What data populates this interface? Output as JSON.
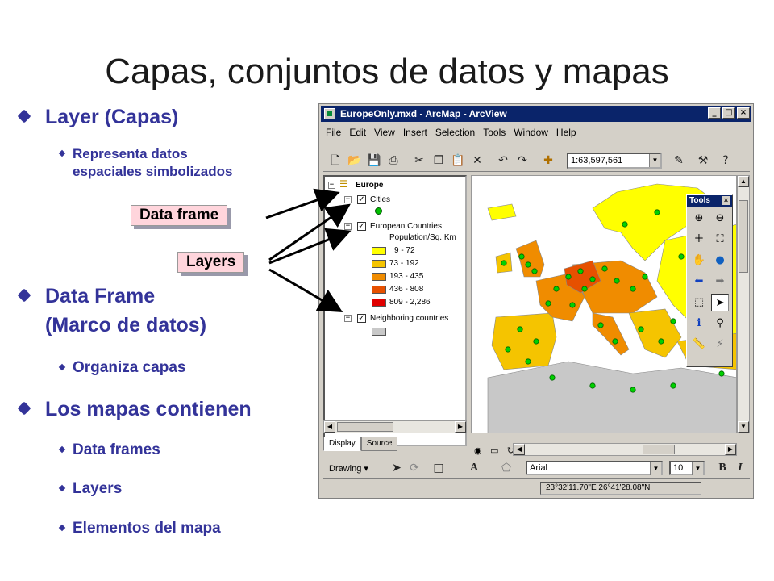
{
  "slide": {
    "title": "Capas, conjuntos de datos y mapas",
    "bullets": [
      {
        "label": "Layer (Capas)",
        "sub": [
          "Representa datos",
          "espaciales simbolizados"
        ]
      },
      {
        "label": "Data Frame",
        "label2": "(Marco de datos)",
        "sub": [
          "Organiza capas"
        ]
      },
      {
        "label": "Los mapas contienen",
        "sub": [
          "Data frames",
          "Layers",
          "Elementos del mapa"
        ]
      }
    ],
    "callouts": {
      "data_frame": "Data frame",
      "layers": "Layers"
    },
    "colors": {
      "bullet": "#333399",
      "callout_bg": "#ffd5dc"
    }
  },
  "window": {
    "title": "EuropeOnly.mxd - ArcMap - ArcView",
    "title_buttons": [
      "_",
      "□",
      "×"
    ],
    "menu": [
      "File",
      "Edit",
      "View",
      "Insert",
      "Selection",
      "Tools",
      "Window",
      "Help"
    ],
    "scale": "1:63,597,561",
    "toc": {
      "data_frame": "Europe",
      "layers": [
        {
          "name": "Cities",
          "checked": true
        },
        {
          "name": "European Countries",
          "checked": true,
          "field": "Population/Sq. Km",
          "classes": [
            {
              "label": "9 - 72",
              "color": "#ffff00"
            },
            {
              "label": "73 - 192",
              "color": "#f5c400"
            },
            {
              "label": "193 - 435",
              "color": "#f08c00"
            },
            {
              "label": "436 - 808",
              "color": "#e65000"
            },
            {
              "label": "809 - 2,286",
              "color": "#e00000"
            }
          ]
        },
        {
          "name": "Neighboring countries",
          "checked": true,
          "swatch": "#c8c8c8"
        }
      ],
      "tabs": [
        "Display",
        "Source"
      ]
    },
    "tools_palette": {
      "title": "Tools",
      "close": "×"
    },
    "drawing": {
      "label": "Drawing",
      "font": "Arial",
      "size": "10",
      "bold": "B",
      "italic": "I",
      "text_tool": "A"
    },
    "status": {
      "coords": "23°32'11.70\"E  26°41'28.08\"N"
    }
  }
}
